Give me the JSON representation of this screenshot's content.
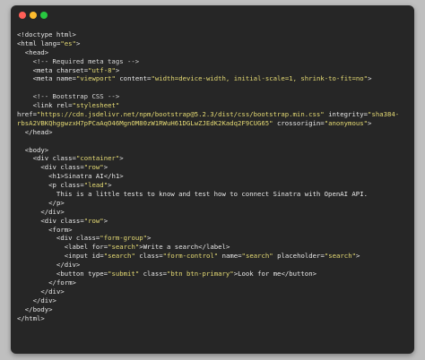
{
  "window": {
    "controls": [
      "close",
      "minimize",
      "maximize"
    ]
  },
  "colors": {
    "background": "#bfbfbf",
    "editor": "#262626",
    "text": "#e8e8e8",
    "string": "#e6db74",
    "close": "#ff5f57",
    "minimize": "#febc2e",
    "maximize": "#28c840"
  },
  "code": {
    "lines": [
      [
        {
          "k": "p",
          "v": "<!doctype html>"
        }
      ],
      [
        {
          "k": "p",
          "v": "<"
        },
        {
          "k": "t",
          "v": "html"
        },
        {
          "k": "p",
          "v": " "
        },
        {
          "k": "a",
          "v": "lang"
        },
        {
          "k": "p",
          "v": "="
        },
        {
          "k": "s",
          "v": "\"es\""
        },
        {
          "k": "p",
          "v": ">"
        }
      ],
      [
        {
          "k": "p",
          "v": "  <"
        },
        {
          "k": "t",
          "v": "head"
        },
        {
          "k": "p",
          "v": ">"
        }
      ],
      [
        {
          "k": "c",
          "v": "    <!-- Required meta tags -->"
        }
      ],
      [
        {
          "k": "p",
          "v": "    <"
        },
        {
          "k": "t",
          "v": "meta"
        },
        {
          "k": "p",
          "v": " "
        },
        {
          "k": "a",
          "v": "charset"
        },
        {
          "k": "p",
          "v": "="
        },
        {
          "k": "s",
          "v": "\"utf-8\""
        },
        {
          "k": "p",
          "v": ">"
        }
      ],
      [
        {
          "k": "p",
          "v": "    <"
        },
        {
          "k": "t",
          "v": "meta"
        },
        {
          "k": "p",
          "v": " "
        },
        {
          "k": "a",
          "v": "name"
        },
        {
          "k": "p",
          "v": "="
        },
        {
          "k": "s",
          "v": "\"viewport\""
        },
        {
          "k": "p",
          "v": " "
        },
        {
          "k": "a",
          "v": "content"
        },
        {
          "k": "p",
          "v": "="
        },
        {
          "k": "s",
          "v": "\"width=device-width, initial-scale=1, shrink-to-fit=no\""
        },
        {
          "k": "p",
          "v": ">"
        }
      ],
      [
        {
          "k": "p",
          "v": ""
        }
      ],
      [
        {
          "k": "c",
          "v": "    <!-- Bootstrap CSS -->"
        }
      ],
      [
        {
          "k": "p",
          "v": "    <"
        },
        {
          "k": "t",
          "v": "link"
        },
        {
          "k": "p",
          "v": " "
        },
        {
          "k": "a",
          "v": "rel"
        },
        {
          "k": "p",
          "v": "="
        },
        {
          "k": "s",
          "v": "\"stylesheet\""
        }
      ],
      [
        {
          "k": "a",
          "v": "href"
        },
        {
          "k": "p",
          "v": "="
        },
        {
          "k": "s",
          "v": "\"https://cdn.jsdelivr.net/npm/bootstrap@5.2.3/dist/css/bootstrap.min.css\""
        },
        {
          "k": "p",
          "v": " "
        },
        {
          "k": "a",
          "v": "integrity"
        },
        {
          "k": "p",
          "v": "="
        },
        {
          "k": "s",
          "v": "\"sha384-"
        }
      ],
      [
        {
          "k": "s",
          "v": "rbsA2VBKQhggwzxH7pPCaAqO46MgnOM80zW1RWuH61DGLwZJEdK2Kadq2F9CUG65\""
        },
        {
          "k": "p",
          "v": " "
        },
        {
          "k": "a",
          "v": "crossorigin"
        },
        {
          "k": "p",
          "v": "="
        },
        {
          "k": "s",
          "v": "\"anonymous\""
        },
        {
          "k": "p",
          "v": ">"
        }
      ],
      [
        {
          "k": "p",
          "v": "  </"
        },
        {
          "k": "t",
          "v": "head"
        },
        {
          "k": "p",
          "v": ">"
        }
      ],
      [
        {
          "k": "p",
          "v": ""
        }
      ],
      [
        {
          "k": "p",
          "v": "  <"
        },
        {
          "k": "t",
          "v": "body"
        },
        {
          "k": "p",
          "v": ">"
        }
      ],
      [
        {
          "k": "p",
          "v": "    <"
        },
        {
          "k": "t",
          "v": "div"
        },
        {
          "k": "p",
          "v": " "
        },
        {
          "k": "a",
          "v": "class"
        },
        {
          "k": "p",
          "v": "="
        },
        {
          "k": "s",
          "v": "\"container\""
        },
        {
          "k": "p",
          "v": ">"
        }
      ],
      [
        {
          "k": "p",
          "v": "      <"
        },
        {
          "k": "t",
          "v": "div"
        },
        {
          "k": "p",
          "v": " "
        },
        {
          "k": "a",
          "v": "class"
        },
        {
          "k": "p",
          "v": "="
        },
        {
          "k": "s",
          "v": "\"row\""
        },
        {
          "k": "p",
          "v": ">"
        }
      ],
      [
        {
          "k": "p",
          "v": "        <"
        },
        {
          "k": "t",
          "v": "h1"
        },
        {
          "k": "p",
          "v": ">"
        },
        {
          "k": "x",
          "v": "Sinatra AI"
        },
        {
          "k": "p",
          "v": "</"
        },
        {
          "k": "t",
          "v": "h1"
        },
        {
          "k": "p",
          "v": ">"
        }
      ],
      [
        {
          "k": "p",
          "v": "        <"
        },
        {
          "k": "t",
          "v": "p"
        },
        {
          "k": "p",
          "v": " "
        },
        {
          "k": "a",
          "v": "class"
        },
        {
          "k": "p",
          "v": "="
        },
        {
          "k": "s",
          "v": "\"lead\""
        },
        {
          "k": "p",
          "v": ">"
        }
      ],
      [
        {
          "k": "x",
          "v": "          This is a little tests to know and test how to connect Sinatra with OpenAI API."
        }
      ],
      [
        {
          "k": "p",
          "v": "        </"
        },
        {
          "k": "t",
          "v": "p"
        },
        {
          "k": "p",
          "v": ">"
        }
      ],
      [
        {
          "k": "p",
          "v": "      </"
        },
        {
          "k": "t",
          "v": "div"
        },
        {
          "k": "p",
          "v": ">"
        }
      ],
      [
        {
          "k": "p",
          "v": "      <"
        },
        {
          "k": "t",
          "v": "div"
        },
        {
          "k": "p",
          "v": " "
        },
        {
          "k": "a",
          "v": "class"
        },
        {
          "k": "p",
          "v": "="
        },
        {
          "k": "s",
          "v": "\"row\""
        },
        {
          "k": "p",
          "v": ">"
        }
      ],
      [
        {
          "k": "p",
          "v": "        <"
        },
        {
          "k": "t",
          "v": "form"
        },
        {
          "k": "p",
          "v": ">"
        }
      ],
      [
        {
          "k": "p",
          "v": "          <"
        },
        {
          "k": "t",
          "v": "div"
        },
        {
          "k": "p",
          "v": " "
        },
        {
          "k": "a",
          "v": "class"
        },
        {
          "k": "p",
          "v": "="
        },
        {
          "k": "s",
          "v": "\"form-group\""
        },
        {
          "k": "p",
          "v": ">"
        }
      ],
      [
        {
          "k": "p",
          "v": "            <"
        },
        {
          "k": "t",
          "v": "label"
        },
        {
          "k": "p",
          "v": " "
        },
        {
          "k": "a",
          "v": "for"
        },
        {
          "k": "p",
          "v": "="
        },
        {
          "k": "s",
          "v": "\"search\""
        },
        {
          "k": "p",
          "v": ">"
        },
        {
          "k": "x",
          "v": "Write a search"
        },
        {
          "k": "p",
          "v": "</"
        },
        {
          "k": "t",
          "v": "label"
        },
        {
          "k": "p",
          "v": ">"
        }
      ],
      [
        {
          "k": "p",
          "v": "            <"
        },
        {
          "k": "t",
          "v": "input"
        },
        {
          "k": "p",
          "v": " "
        },
        {
          "k": "a",
          "v": "id"
        },
        {
          "k": "p",
          "v": "="
        },
        {
          "k": "s",
          "v": "\"search\""
        },
        {
          "k": "p",
          "v": " "
        },
        {
          "k": "a",
          "v": "class"
        },
        {
          "k": "p",
          "v": "="
        },
        {
          "k": "s",
          "v": "\"form-control\""
        },
        {
          "k": "p",
          "v": " "
        },
        {
          "k": "a",
          "v": "name"
        },
        {
          "k": "p",
          "v": "="
        },
        {
          "k": "s",
          "v": "\"search\""
        },
        {
          "k": "p",
          "v": " "
        },
        {
          "k": "a",
          "v": "placeholder"
        },
        {
          "k": "p",
          "v": "="
        },
        {
          "k": "s",
          "v": "\"search\""
        },
        {
          "k": "p",
          "v": ">"
        }
      ],
      [
        {
          "k": "p",
          "v": "          </"
        },
        {
          "k": "t",
          "v": "div"
        },
        {
          "k": "p",
          "v": ">"
        }
      ],
      [
        {
          "k": "p",
          "v": "          <"
        },
        {
          "k": "t",
          "v": "button"
        },
        {
          "k": "p",
          "v": " "
        },
        {
          "k": "a",
          "v": "type"
        },
        {
          "k": "p",
          "v": "="
        },
        {
          "k": "s",
          "v": "\"submit\""
        },
        {
          "k": "p",
          "v": " "
        },
        {
          "k": "a",
          "v": "class"
        },
        {
          "k": "p",
          "v": "="
        },
        {
          "k": "s",
          "v": "\"btn btn-primary\""
        },
        {
          "k": "p",
          "v": ">"
        },
        {
          "k": "x",
          "v": "Look for me"
        },
        {
          "k": "p",
          "v": "</"
        },
        {
          "k": "t",
          "v": "button"
        },
        {
          "k": "p",
          "v": ">"
        }
      ],
      [
        {
          "k": "p",
          "v": "        </"
        },
        {
          "k": "t",
          "v": "form"
        },
        {
          "k": "p",
          "v": ">"
        }
      ],
      [
        {
          "k": "p",
          "v": "      </"
        },
        {
          "k": "t",
          "v": "div"
        },
        {
          "k": "p",
          "v": ">"
        }
      ],
      [
        {
          "k": "p",
          "v": "    </"
        },
        {
          "k": "t",
          "v": "div"
        },
        {
          "k": "p",
          "v": ">"
        }
      ],
      [
        {
          "k": "p",
          "v": "  </"
        },
        {
          "k": "t",
          "v": "body"
        },
        {
          "k": "p",
          "v": ">"
        }
      ],
      [
        {
          "k": "p",
          "v": "</"
        },
        {
          "k": "t",
          "v": "html"
        },
        {
          "k": "p",
          "v": ">"
        }
      ]
    ]
  }
}
